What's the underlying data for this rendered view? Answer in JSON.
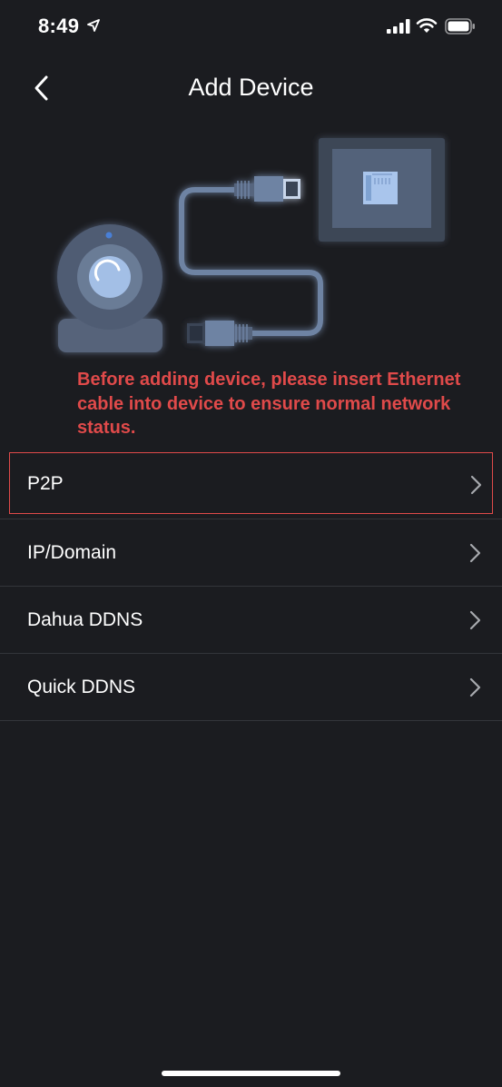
{
  "status_bar": {
    "time": "8:49",
    "icons": [
      "location-arrow-icon",
      "signal-bars-icon",
      "wifi-icon",
      "battery-icon"
    ]
  },
  "nav": {
    "title": "Add Device",
    "back_icon": "chevron-left-icon"
  },
  "illustration": {
    "description_icons": [
      "camera-icon",
      "ethernet-cable-icon",
      "ethernet-port-icon"
    ]
  },
  "notice": {
    "text": "Before adding device, please insert Ethernet cable into device to ensure normal network status.",
    "color": "#e04a4a"
  },
  "menu": {
    "items": [
      {
        "label": "P2P",
        "selected": true
      },
      {
        "label": "IP/Domain",
        "selected": false
      },
      {
        "label": "Dahua DDNS",
        "selected": false
      },
      {
        "label": "Quick DDNS",
        "selected": false
      }
    ]
  },
  "colors": {
    "background": "#1b1c20",
    "accent_red": "#e04a4a",
    "divider": "#33353a",
    "illustration_blue": "#6e83a3"
  }
}
